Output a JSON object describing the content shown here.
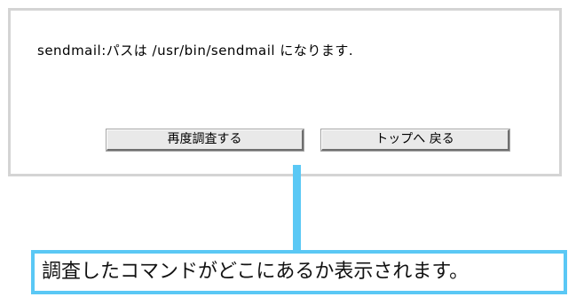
{
  "result": {
    "message": "sendmail:パスは /usr/bin/sendmail になります."
  },
  "buttons": {
    "retry_label": "再度調査する",
    "top_label": "トップへ 戻る"
  },
  "annotation": {
    "text": "調査したコマンドがどこにあるか表示されます。"
  },
  "colors": {
    "panel_border": "#d4d4d4",
    "button_face": "#e9e9e9",
    "callout_accent": "#5ac8f5"
  }
}
